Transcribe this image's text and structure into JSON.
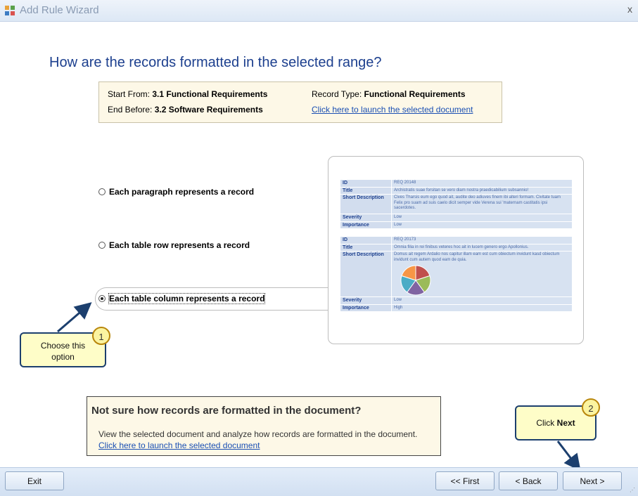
{
  "window": {
    "title": "Add Rule Wizard",
    "close": "x"
  },
  "heading": "How are the records formatted in the selected range?",
  "info": {
    "start_from_label": "Start From:",
    "start_from_value": "3.1 Functional Requirements",
    "end_before_label": "End Before:",
    "end_before_value": "3.2 Software Requirements",
    "record_type_label": "Record Type:",
    "record_type_value": "Functional Requirements",
    "launch_link": "Click here to launch the selected document"
  },
  "options": [
    {
      "label": "Each paragraph represents a record",
      "selected": false
    },
    {
      "label": "Each table row represents a record",
      "selected": false
    },
    {
      "label": "Each table column represents a record",
      "selected": true
    }
  ],
  "preview": {
    "records": [
      {
        "rows": [
          {
            "key": "ID",
            "value": "REQ 20148"
          },
          {
            "key": "Title",
            "value": "Archistratis suae forsitan se vero diam nostra praedicabilium subsannio!"
          },
          {
            "key": "Short Description",
            "value": "Cives Tharsis eum ego quod ait, audite deo adiuves finem ibi alteri formam. Civitate tuam Felix pro suam ad suis caelo dicit semper vide Verena sui 'maternam castitatis ipsi sacerdotes."
          },
          {
            "key": "Severity",
            "value": "Low"
          },
          {
            "key": "Importance",
            "value": "Low"
          }
        ]
      },
      {
        "rows": [
          {
            "key": "ID",
            "value": "REQ 20173"
          },
          {
            "key": "Title",
            "value": "Omnia filia in rei finibus veteres hoc ait in lucem genero ergo Apollonius."
          },
          {
            "key": "Short Description",
            "value": "Domus ait regem Ardalio nos capitur illam eam est cum obiectum invidunt kasd obiectum invidunt cum autem quod eam de quia."
          },
          {
            "key": "Severity",
            "value": "Low"
          },
          {
            "key": "Importance",
            "value": "High"
          }
        ]
      }
    ],
    "pie_colors": [
      "#c0504d",
      "#9bbb59",
      "#8064a2",
      "#4bacc6",
      "#f79646"
    ]
  },
  "callouts": {
    "one": {
      "number": "1",
      "text": "Choose this option"
    },
    "two": {
      "number": "2",
      "text_prefix": "Click ",
      "text_bold": "Next"
    }
  },
  "help": {
    "title": "Not sure how records are formatted in the document?",
    "text": "View the selected document and analyze how records are formatted in the document.",
    "link": "Click here to launch the selected document "
  },
  "buttons": {
    "exit": "Exit",
    "first": "<< First",
    "back": "< Back",
    "next": "Next >"
  },
  "colors": {
    "accent": "#1c3f8e",
    "callout_fill": "#fefdc8",
    "arrow": "#1c3f6e"
  }
}
